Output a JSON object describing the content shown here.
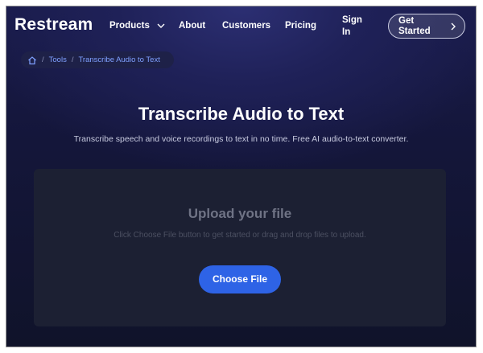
{
  "nav": {
    "logo": "Restream",
    "products": "Products",
    "about": "About",
    "customers": "Customers",
    "pricing": "Pricing",
    "sign_in": "Sign In",
    "get_started": "Get Started"
  },
  "breadcrumb": {
    "items": [
      "Tools",
      "Transcribe Audio to Text"
    ]
  },
  "hero": {
    "title": "Transcribe Audio to Text",
    "subtitle": "Transcribe speech and voice recordings to text in no time. Free AI audio-to-text converter."
  },
  "upload": {
    "title": "Upload your file",
    "hint": "Click Choose File button to get started or drag and drop files to upload.",
    "button_label": "Choose File"
  },
  "colors": {
    "accent": "#2e63e6",
    "breadcrumb_link": "#7fa0ff"
  },
  "icons": [
    "chevron-down-icon",
    "chevron-right-icon",
    "home-icon"
  ]
}
